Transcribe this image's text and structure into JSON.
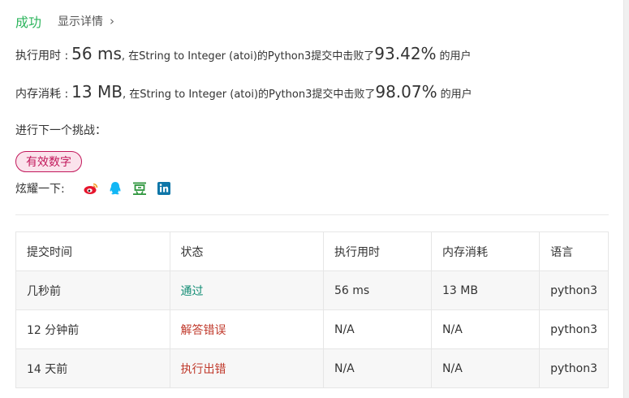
{
  "result": {
    "status": "成功",
    "details_label": "显示详情",
    "details_chevron": "›"
  },
  "runtime": {
    "label": "执行用时 : ",
    "value": "56 ms",
    "text": ", 在String to Integer (atoi)的Python3提交中击败了",
    "percent": "93.42%",
    "suffix": "的用户"
  },
  "memory": {
    "label": "内存消耗 : ",
    "value": "13 MB",
    "text": ", 在String to Integer (atoi)的Python3提交中击败了",
    "percent": "98.07%",
    "suffix": "的用户"
  },
  "next": {
    "label": "进行下一个挑战",
    "colon": "：",
    "tag": "有效数字"
  },
  "share": {
    "label": "炫耀一下:",
    "icons": [
      "weibo-icon",
      "qq-icon",
      "douban-icon",
      "linkedin-icon"
    ]
  },
  "table": {
    "headers": [
      "提交时间",
      "状态",
      "执行用时",
      "内存消耗",
      "语言"
    ],
    "rows": [
      {
        "time": "几秒前",
        "status": "通过",
        "runtime": "56 ms",
        "memory": "13 MB",
        "lang": "python3"
      },
      {
        "time": "12 分钟前",
        "status": "解答错误",
        "runtime": "N/A",
        "memory": "N/A",
        "lang": "python3"
      },
      {
        "time": "14 天前",
        "status": "执行出错",
        "runtime": "N/A",
        "memory": "N/A",
        "lang": "python3"
      }
    ]
  },
  "colors": {
    "success": "#2db55d",
    "accepted": "#138d75",
    "error": "#c0392b",
    "tag": "#c2185b"
  }
}
